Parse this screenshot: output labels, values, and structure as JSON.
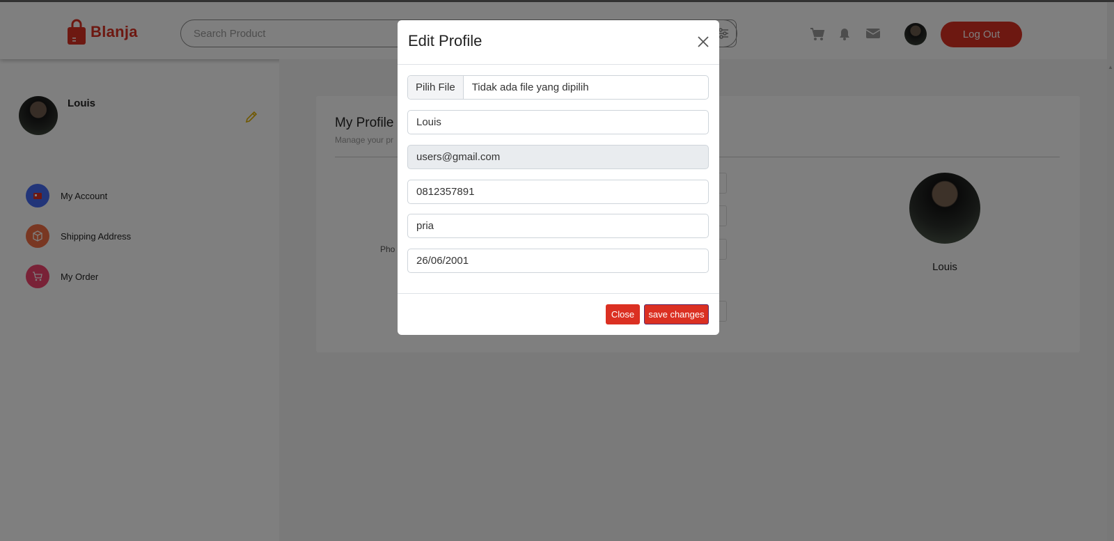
{
  "header": {
    "brand": "Blanja",
    "search_placeholder": "Search Product",
    "logout_label": "Log Out",
    "icons": [
      "cart-icon",
      "bell-icon",
      "mail-icon",
      "filter-icon"
    ]
  },
  "sidebar": {
    "user_name": "Louis",
    "items": [
      {
        "label": "My Account",
        "icon": "user-icon",
        "color": "#456bf3"
      },
      {
        "label": "Shipping Address",
        "icon": "box-icon",
        "color": "#f36f45"
      },
      {
        "label": "My Order",
        "icon": "cart-icon",
        "color": "#f3456f"
      }
    ]
  },
  "profile": {
    "title": "My Profile",
    "subtitle": "Manage your pr",
    "partial_label": "Pho",
    "avatar_name": "Louis"
  },
  "modal": {
    "title": "Edit Profile",
    "file_button": "Pilih File",
    "file_text": "Tidak ada file yang dipilih",
    "name_value": "Louis",
    "email_value": "users@gmail.com",
    "phone_value": "0812357891",
    "gender_value": "pria",
    "birth_value": "26/06/2001",
    "close_label": "Close",
    "save_label": "save changes"
  },
  "colors": {
    "accent": "#db3022",
    "overlay": "rgba(0,0,0,0.5)"
  }
}
